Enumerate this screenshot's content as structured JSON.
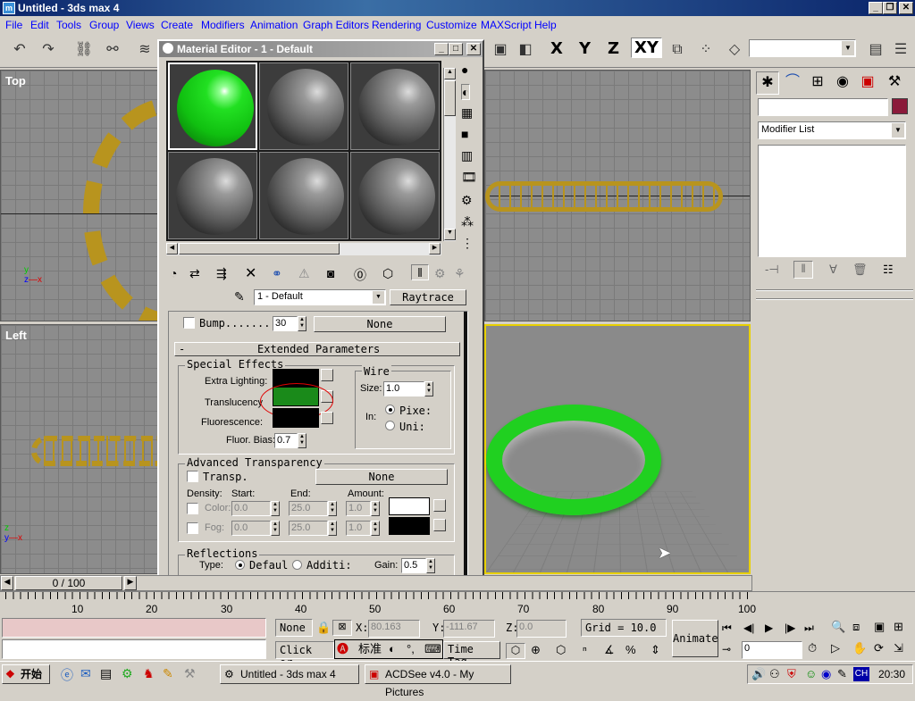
{
  "app": {
    "title": "Untitled - 3ds max 4",
    "menus": [
      "File",
      "Edit",
      "Tools",
      "Group",
      "Views",
      "Create",
      "Modifiers",
      "Animation",
      "Graph Editors",
      "Rendering",
      "Customize",
      "MAXScript",
      "Help"
    ]
  },
  "toolbar": {
    "axis_x": "X",
    "axis_y": "Y",
    "axis_z": "Z",
    "axis_xy": "XY"
  },
  "viewports": {
    "top_label": "Top",
    "left_label": "Left",
    "perspective_active": true
  },
  "command_panel": {
    "modifier_list": "Modifier List",
    "name_value": "",
    "color": "#8b1a3a"
  },
  "material_editor": {
    "title": "Material Editor - 1 - Default",
    "material_name": "1 - Default",
    "material_type": "Raytrace",
    "bump_label": "Bump.......",
    "bump_value": "30",
    "bump_map": "None",
    "extended_rollout": "Extended Parameters",
    "special_effects": {
      "title": "Special Effects",
      "extra_lighting": "Extra Lighting:",
      "translucency": "Translucency",
      "fluorescence": "Fluorescence:",
      "fluor_bias_label": "Fluor. Bias:",
      "fluor_bias": "0.7",
      "translucency_color": "#1a8a1a",
      "extra_lighting_color": "#000000",
      "fluorescence_color": "#000000"
    },
    "wire": {
      "title": "Wire",
      "size_label": "Size:",
      "size": "1.0",
      "in_label": "In:",
      "pixels": "Pixe:",
      "units": "Uni:"
    },
    "advanced_transparency": {
      "title": "Advanced Transparency",
      "transp": "Transp.",
      "transp_map": "None",
      "density": "Density:",
      "start": "Start:",
      "end": "End:",
      "amount": "Amount:",
      "color_label": "Color:",
      "color_start": "0.0",
      "color_end": "25.0",
      "color_amount": "1.0",
      "fog_label": "Fog:",
      "fog_start": "0.0",
      "fog_end": "25.0",
      "fog_amount": "1.0"
    },
    "reflections": {
      "title": "Reflections",
      "type": "Type:",
      "default": "Defaul",
      "additive": "Additi:",
      "gain_label": "Gain:",
      "gain": "0.5"
    }
  },
  "timeline": {
    "frame": "0 / 100",
    "ticks": [
      "10",
      "20",
      "30",
      "40",
      "50",
      "60",
      "70",
      "80",
      "90",
      "100"
    ]
  },
  "status": {
    "selection": "None",
    "x_label": "X:",
    "x": "80.163",
    "y_label": "Y:",
    "y": "-111.67",
    "z_label": "Z:",
    "z": "0.0",
    "grid": "Grid = 10.0",
    "prompt": "Click or",
    "time_tag": "Time Tag",
    "animate": "Animate",
    "frame_field": "0",
    "ime": "标准"
  },
  "taskbar": {
    "start": "开始",
    "tasks": [
      "Untitled - 3ds max 4",
      "ACDSee v4.0 - My Pictures"
    ],
    "clock": "20:30",
    "lang": "CH"
  }
}
